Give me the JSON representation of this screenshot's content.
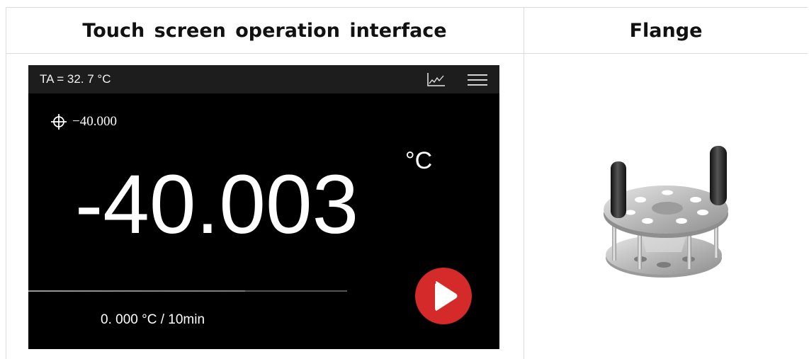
{
  "headers": {
    "left": "Touch screen operation interface",
    "right": "Flange"
  },
  "screen": {
    "ambient_temp": "TA = 32. 7 °C",
    "setpoint": "−40.000",
    "current_temp": "-40.003",
    "unit": "°C",
    "rate": "0. 000 °C / 10min",
    "progress_fraction": 0.68
  },
  "colors": {
    "screen_bg": "#000000",
    "topbar_bg": "#1d1d1d",
    "play_button": "#d42a2a"
  },
  "icons": {
    "crosshair": "crosshair-icon",
    "chart": "chart-icon",
    "menu": "menu-icon",
    "play": "play-icon"
  }
}
